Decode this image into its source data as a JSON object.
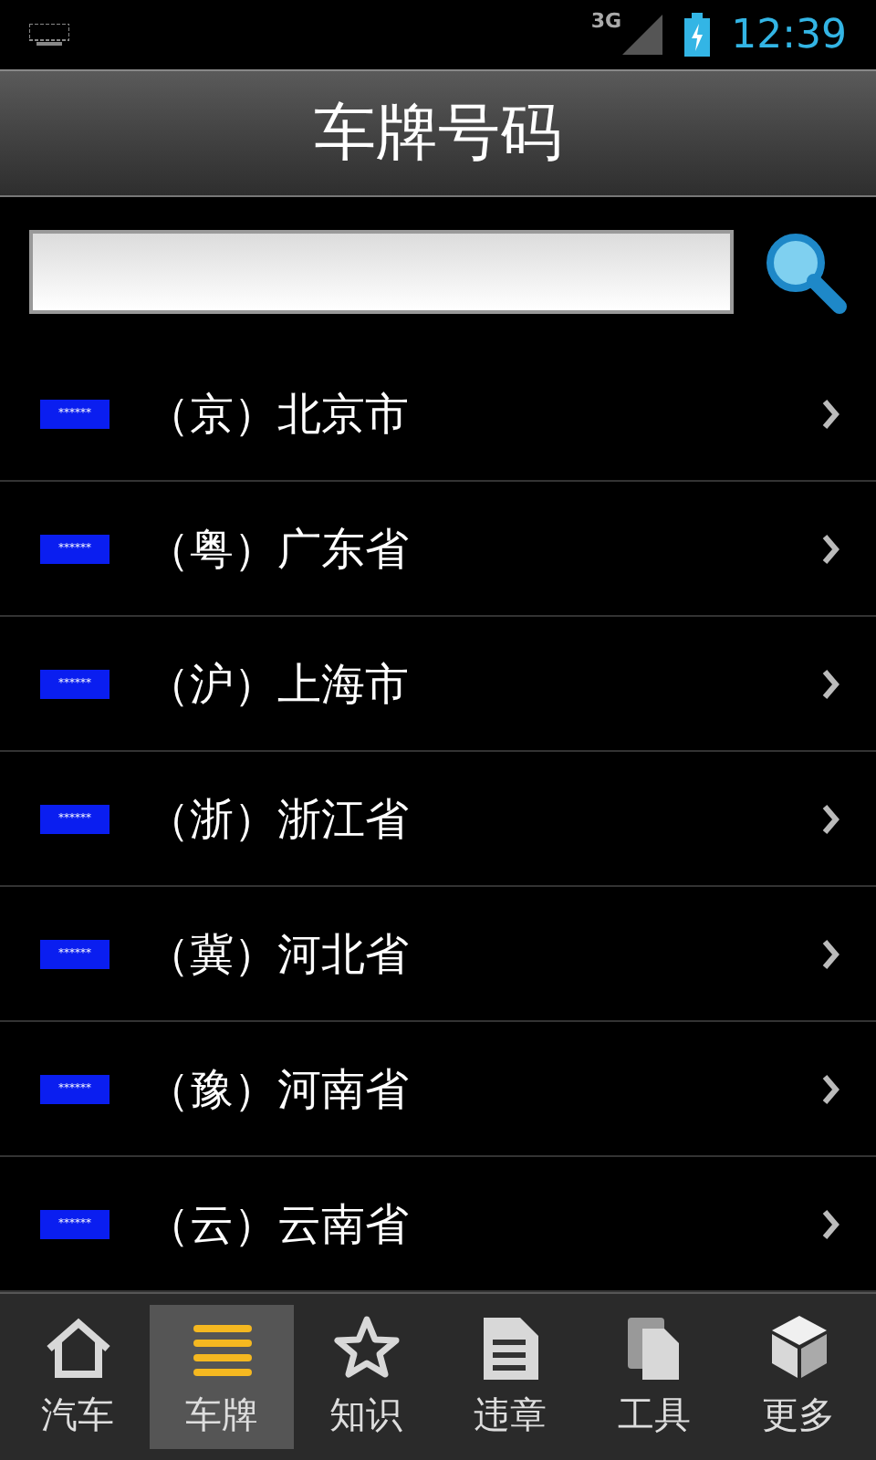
{
  "status_bar": {
    "network": "3G",
    "time": "12:39"
  },
  "title": "车牌号码",
  "rows": [
    {
      "plate": "******",
      "abbr": "（京）",
      "name": "北京市"
    },
    {
      "plate": "******",
      "abbr": "（粤）",
      "name": "广东省"
    },
    {
      "plate": "******",
      "abbr": "（沪）",
      "name": "上海市"
    },
    {
      "plate": "******",
      "abbr": "（浙）",
      "name": "浙江省"
    },
    {
      "plate": "******",
      "abbr": "（冀）",
      "name": "河北省"
    },
    {
      "plate": "******",
      "abbr": "（豫）",
      "name": "河南省"
    },
    {
      "plate": "******",
      "abbr": "（云）",
      "name": "云南省"
    }
  ],
  "tabs": [
    {
      "kind": "home",
      "label": "汽车",
      "selected": false
    },
    {
      "kind": "list",
      "label": "车牌",
      "selected": true
    },
    {
      "kind": "star",
      "label": "知识",
      "selected": false
    },
    {
      "kind": "doc",
      "label": "违章",
      "selected": false
    },
    {
      "kind": "copy",
      "label": "工具",
      "selected": false
    },
    {
      "kind": "cube",
      "label": "更多",
      "selected": false
    }
  ]
}
